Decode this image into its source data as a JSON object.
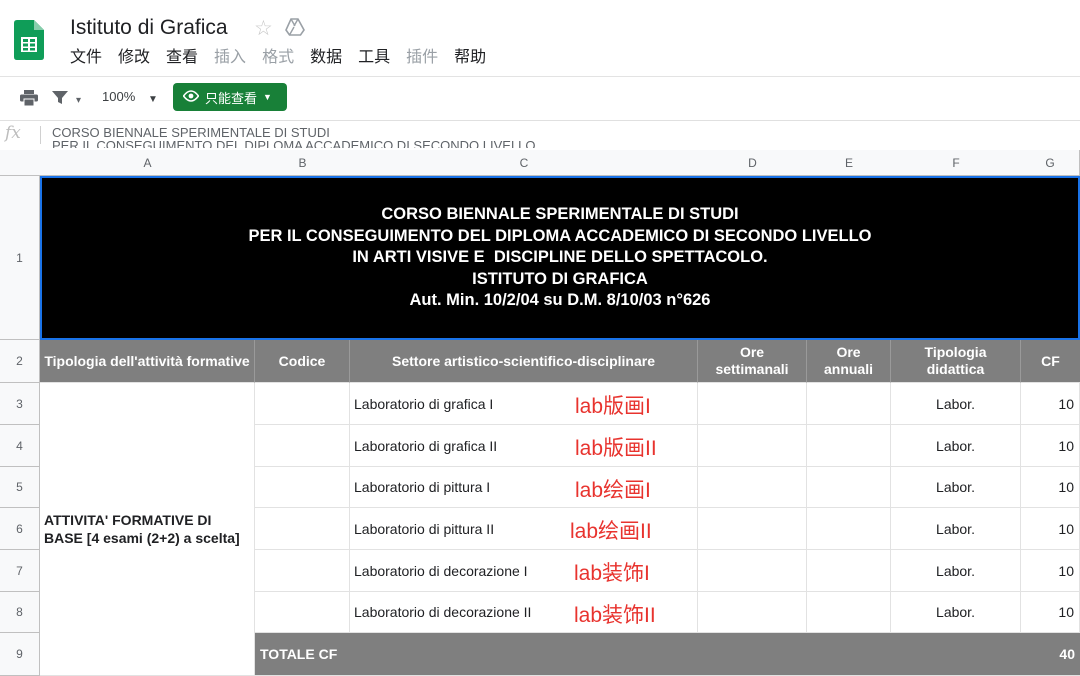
{
  "header": {
    "title": "Istituto di Grafica",
    "menu": [
      {
        "label": "文件",
        "enabled": true
      },
      {
        "label": "修改",
        "enabled": true
      },
      {
        "label": "查看",
        "enabled": true
      },
      {
        "label": "插入",
        "enabled": false
      },
      {
        "label": "格式",
        "enabled": false
      },
      {
        "label": "数据",
        "enabled": true
      },
      {
        "label": "工具",
        "enabled": true
      },
      {
        "label": "插件",
        "enabled": false
      },
      {
        "label": "帮助",
        "enabled": true
      }
    ]
  },
  "toolbar": {
    "zoom": "100%",
    "view_only_label": "只能查看",
    "icons": [
      "print-icon",
      "filter-icon",
      "eye-icon"
    ],
    "accent": "#188038"
  },
  "formula_bar": {
    "fx": "fx",
    "text": "CORSO BIENNALE SPERIMENTALE DI STUDI\nPER IL CONSEGUIMENTO DEL DIPLOMA ACCADEMICO DI SECONDO LIVELLO"
  },
  "sheet": {
    "columns": [
      "A",
      "B",
      "C",
      "D",
      "E",
      "F",
      "G"
    ],
    "rows": [
      "1",
      "2",
      "3",
      "4",
      "5",
      "6",
      "7",
      "8",
      "9"
    ],
    "title_lines": [
      "CORSO BIENNALE SPERIMENTALE DI STUDI",
      "PER IL CONSEGUIMENTO DEL DIPLOMA ACCADEMICO DI SECONDO LIVELLO",
      "IN ARTI VISIVE E  DISCIPLINE DELLO SPETTACOLO.",
      "ISTITUTO DI GRAFICA",
      "Aut. Min. 10/2/04 su D.M. 8/10/03 n°626"
    ],
    "headers": {
      "tipologia_attivita": "Tipologia dell'attività formative",
      "codice": "Codice",
      "settore": "Settore artistico-scientifico-disciplinare",
      "ore_settimanali": "Ore settimanali",
      "ore_annuali": "Ore annuali",
      "tipologia_didattica": "Tipologia didattica",
      "cf": "CF"
    },
    "group_label": "ATTIVITA' FORMATIVE DI BASE [4 esami (2+2) a scelta]",
    "courses": [
      {
        "name": "Laboratorio di grafica I",
        "annotation": "lab版画I",
        "tipologia": "Labor.",
        "cf": "10"
      },
      {
        "name": "Laboratorio di grafica II",
        "annotation": "lab版画II",
        "tipologia": "Labor.",
        "cf": "10"
      },
      {
        "name": "Laboratorio di pittura I",
        "annotation": "lab绘画I",
        "tipologia": "Labor.",
        "cf": "10"
      },
      {
        "name": "Laboratorio di pittura II",
        "annotation": "lab绘画II",
        "tipologia": "Labor.",
        "cf": "10"
      },
      {
        "name": "Laboratorio di decorazione I",
        "annotation": "lab装饰I",
        "tipologia": "Labor.",
        "cf": "10"
      },
      {
        "name": "Laboratorio di decorazione II",
        "annotation": "lab装饰II",
        "tipologia": "Labor.",
        "cf": "10"
      }
    ],
    "total_label": "TOTALE CF",
    "total_cf": "40",
    "annotation_color": "#e8332e",
    "header_fill": "#7f7f7f"
  }
}
